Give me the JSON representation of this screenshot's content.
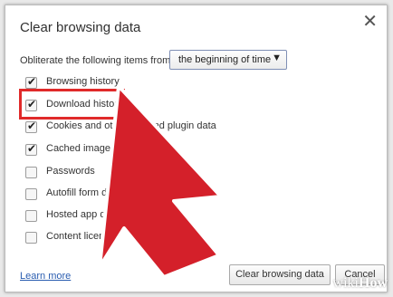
{
  "dialog": {
    "title": "Clear browsing data",
    "close_glyph": "✕"
  },
  "range": {
    "label": "Obliterate the following items from:",
    "selected": "the beginning of time"
  },
  "items": [
    {
      "label": "Browsing history",
      "checked": true
    },
    {
      "label": "Download history",
      "checked": true
    },
    {
      "label": "Cookies and other site and plugin data",
      "checked": true
    },
    {
      "label": "Cached images and files",
      "checked": true
    },
    {
      "label": "Passwords",
      "checked": false
    },
    {
      "label": "Autofill form data",
      "checked": false
    },
    {
      "label": "Hosted app data",
      "checked": false
    },
    {
      "label": "Content licenses",
      "checked": false
    }
  ],
  "footer": {
    "learn_more": "Learn more",
    "clear_button": "Clear browsing data",
    "cancel_button": "Cancel"
  },
  "colors": {
    "highlight": "#e02a2a",
    "arrow": "#d4202a",
    "link": "#2a5db0"
  },
  "icons": {
    "close": "close-icon",
    "dropdown": "chevron-down-icon",
    "pointer": "pointer-arrow"
  },
  "watermark": {
    "prefix": "wiki",
    "suffix": "How"
  }
}
